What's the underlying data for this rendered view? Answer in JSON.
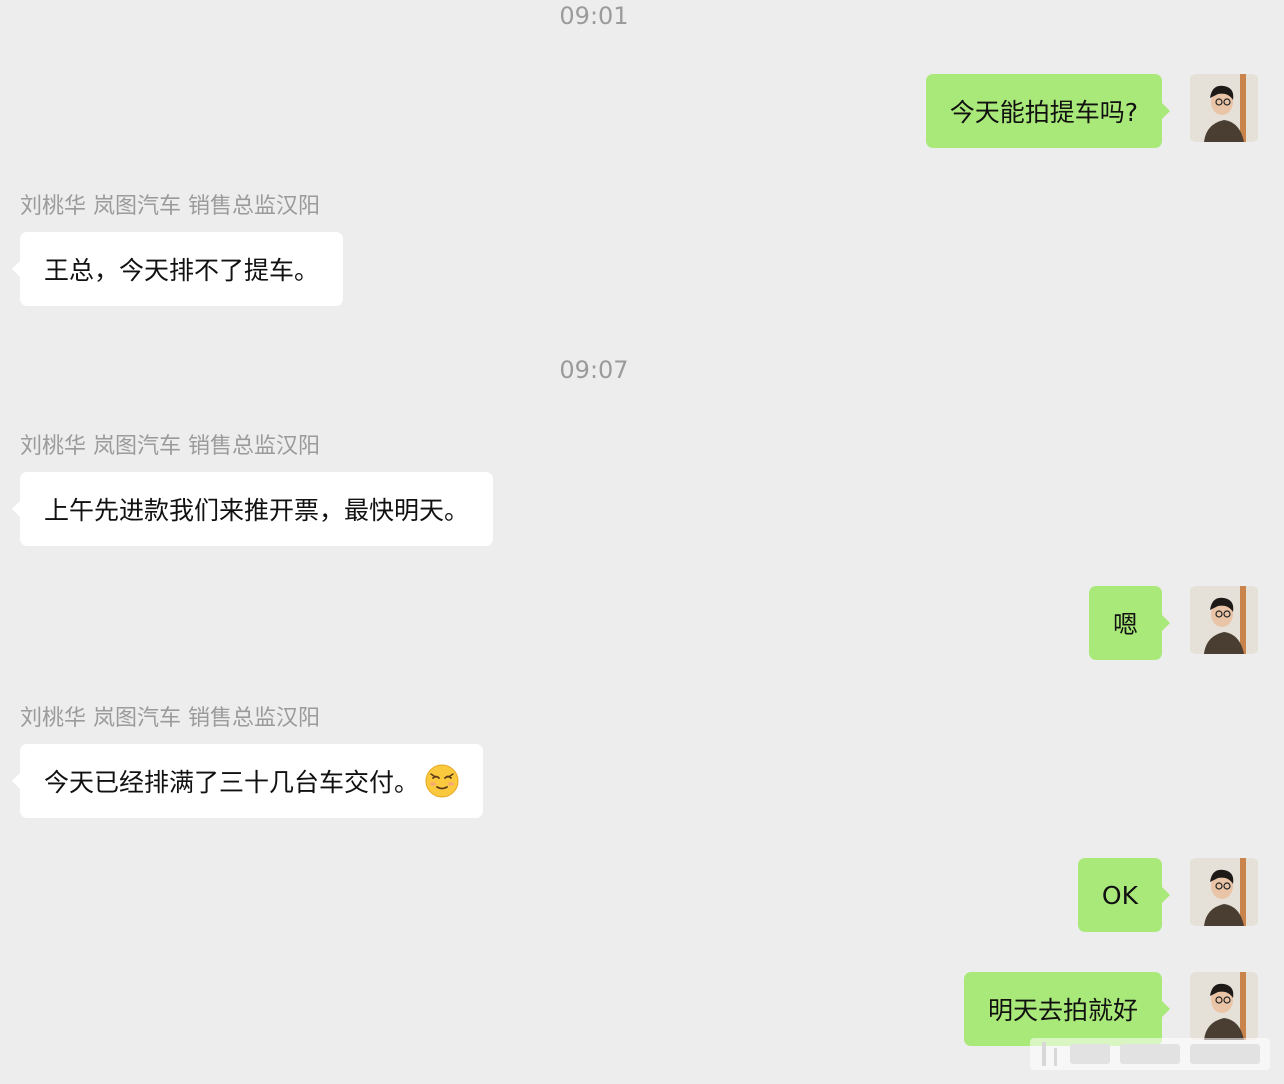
{
  "messages": [
    {
      "kind": "time",
      "text": "09:01"
    },
    {
      "kind": "out",
      "text": "今天能拍提车吗?"
    },
    {
      "kind": "in",
      "sender": "刘桃华 岚图汽车 销售总监汉阳",
      "text": "王总，今天排不了提车。"
    },
    {
      "kind": "time",
      "text": "09:07"
    },
    {
      "kind": "in",
      "sender": "刘桃华 岚图汽车 销售总监汉阳",
      "text": "上午先进款我们来推开票，最快明天。"
    },
    {
      "kind": "out",
      "text": "嗯"
    },
    {
      "kind": "in",
      "sender": "刘桃华 岚图汽车 销售总监汉阳",
      "text": "今天已经排满了三十几台车交付。",
      "emoji": "relieved-face-emoji"
    },
    {
      "kind": "out",
      "text": "OK"
    },
    {
      "kind": "out",
      "text": "明天去拍就好"
    }
  ],
  "colors": {
    "background": "#ededed",
    "outgoing_bubble": "#a9e979",
    "incoming_bubble": "#ffffff",
    "meta_text": "#9b9b9b"
  },
  "icons": [
    "user-avatar",
    "relieved-face-emoji",
    "watermark"
  ]
}
